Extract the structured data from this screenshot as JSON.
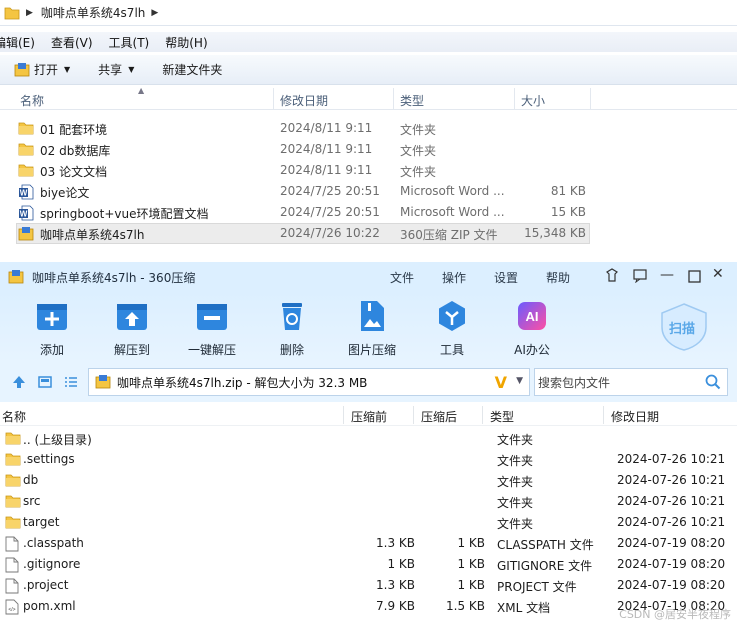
{
  "explorer": {
    "address_crumb": "咖啡点单系统4s7lh",
    "menu": [
      "编辑(E)",
      "查看(V)",
      "工具(T)",
      "帮助(H)"
    ],
    "commands": {
      "open": "打开",
      "share": "共享",
      "new_folder": "新建文件夹"
    },
    "columns": {
      "name": "名称",
      "date": "修改日期",
      "type": "类型",
      "size": "大小"
    },
    "rows": [
      {
        "icon": "folder-icon",
        "name": "01 配套环境",
        "date": "2024/8/11 9:11",
        "type": "文件夹",
        "size": ""
      },
      {
        "icon": "folder-icon",
        "name": "02 db数据库",
        "date": "2024/8/11 9:11",
        "type": "文件夹",
        "size": ""
      },
      {
        "icon": "folder-icon",
        "name": "03 论文文档",
        "date": "2024/8/11 9:11",
        "type": "文件夹",
        "size": ""
      },
      {
        "icon": "word-doc-icon",
        "name": "biye论文",
        "date": "2024/7/25 20:51",
        "type": "Microsoft Word ...",
        "size": "81 KB"
      },
      {
        "icon": "word-doc-icon",
        "name": "springboot+vue环境配置文档",
        "date": "2024/7/25 20:51",
        "type": "Microsoft Word ...",
        "size": "15 KB"
      },
      {
        "icon": "zip-archive-icon",
        "name": "咖啡点单系统4s7lh",
        "date": "2024/7/26 10:22",
        "type": "360压缩 ZIP 文件",
        "size": "15,348 KB",
        "selected": true
      }
    ]
  },
  "zip_window": {
    "title": "咖啡点单系统4s7lh - 360压缩",
    "menu": [
      "文件",
      "操作",
      "设置",
      "帮助"
    ],
    "tools": [
      {
        "icon": "add-icon",
        "label": "添加"
      },
      {
        "icon": "extract-to-icon",
        "label": "解压到"
      },
      {
        "icon": "one-click-extract-icon",
        "label": "一键解压"
      },
      {
        "icon": "delete-icon",
        "label": "删除"
      },
      {
        "icon": "image-compress-icon",
        "label": "图片压缩"
      },
      {
        "icon": "tools-icon",
        "label": "工具"
      },
      {
        "icon": "ai-office-icon",
        "label": "AI办公"
      }
    ],
    "scan_label": "扫描",
    "path_text": "咖啡点单系统4s7lh.zip - 解包大小为 32.3 MB",
    "search_placeholder": "搜索包内文件",
    "columns": {
      "name": "名称",
      "orig": "压缩前",
      "comp": "压缩后",
      "type": "类型",
      "modified": "修改日期"
    },
    "rows": [
      {
        "icon": "folder-icon",
        "name": ".. (上级目录)",
        "orig": "",
        "comp": "",
        "type": "文件夹",
        "modified": ""
      },
      {
        "icon": "folder-icon",
        "name": ".settings",
        "orig": "",
        "comp": "",
        "type": "文件夹",
        "modified": "2024-07-26 10:21"
      },
      {
        "icon": "folder-icon",
        "name": "db",
        "orig": "",
        "comp": "",
        "type": "文件夹",
        "modified": "2024-07-26 10:21"
      },
      {
        "icon": "folder-icon",
        "name": "src",
        "orig": "",
        "comp": "",
        "type": "文件夹",
        "modified": "2024-07-26 10:21"
      },
      {
        "icon": "folder-icon",
        "name": "target",
        "orig": "",
        "comp": "",
        "type": "文件夹",
        "modified": "2024-07-26 10:21"
      },
      {
        "icon": "file-icon",
        "name": ".classpath",
        "orig": "1.3 KB",
        "comp": "1 KB",
        "type": "CLASSPATH 文件",
        "modified": "2024-07-19 08:20"
      },
      {
        "icon": "file-icon",
        "name": ".gitignore",
        "orig": "1 KB",
        "comp": "1 KB",
        "type": "GITIGNORE 文件",
        "modified": "2024-07-19 08:20"
      },
      {
        "icon": "file-icon",
        "name": ".project",
        "orig": "1.3 KB",
        "comp": "1 KB",
        "type": "PROJECT 文件",
        "modified": "2024-07-19 08:20"
      },
      {
        "icon": "xml-file-icon",
        "name": "pom.xml",
        "orig": "7.9 KB",
        "comp": "1.5 KB",
        "type": "XML 文档",
        "modified": "2024-07-19 08:20"
      }
    ],
    "watermark": "CSDN @居安半夜程序"
  },
  "colors": {
    "accent_blue": "#2e86de",
    "title_bg": "#dcefff",
    "folder_yellow": "#f4c542",
    "selection": "#ececec"
  }
}
